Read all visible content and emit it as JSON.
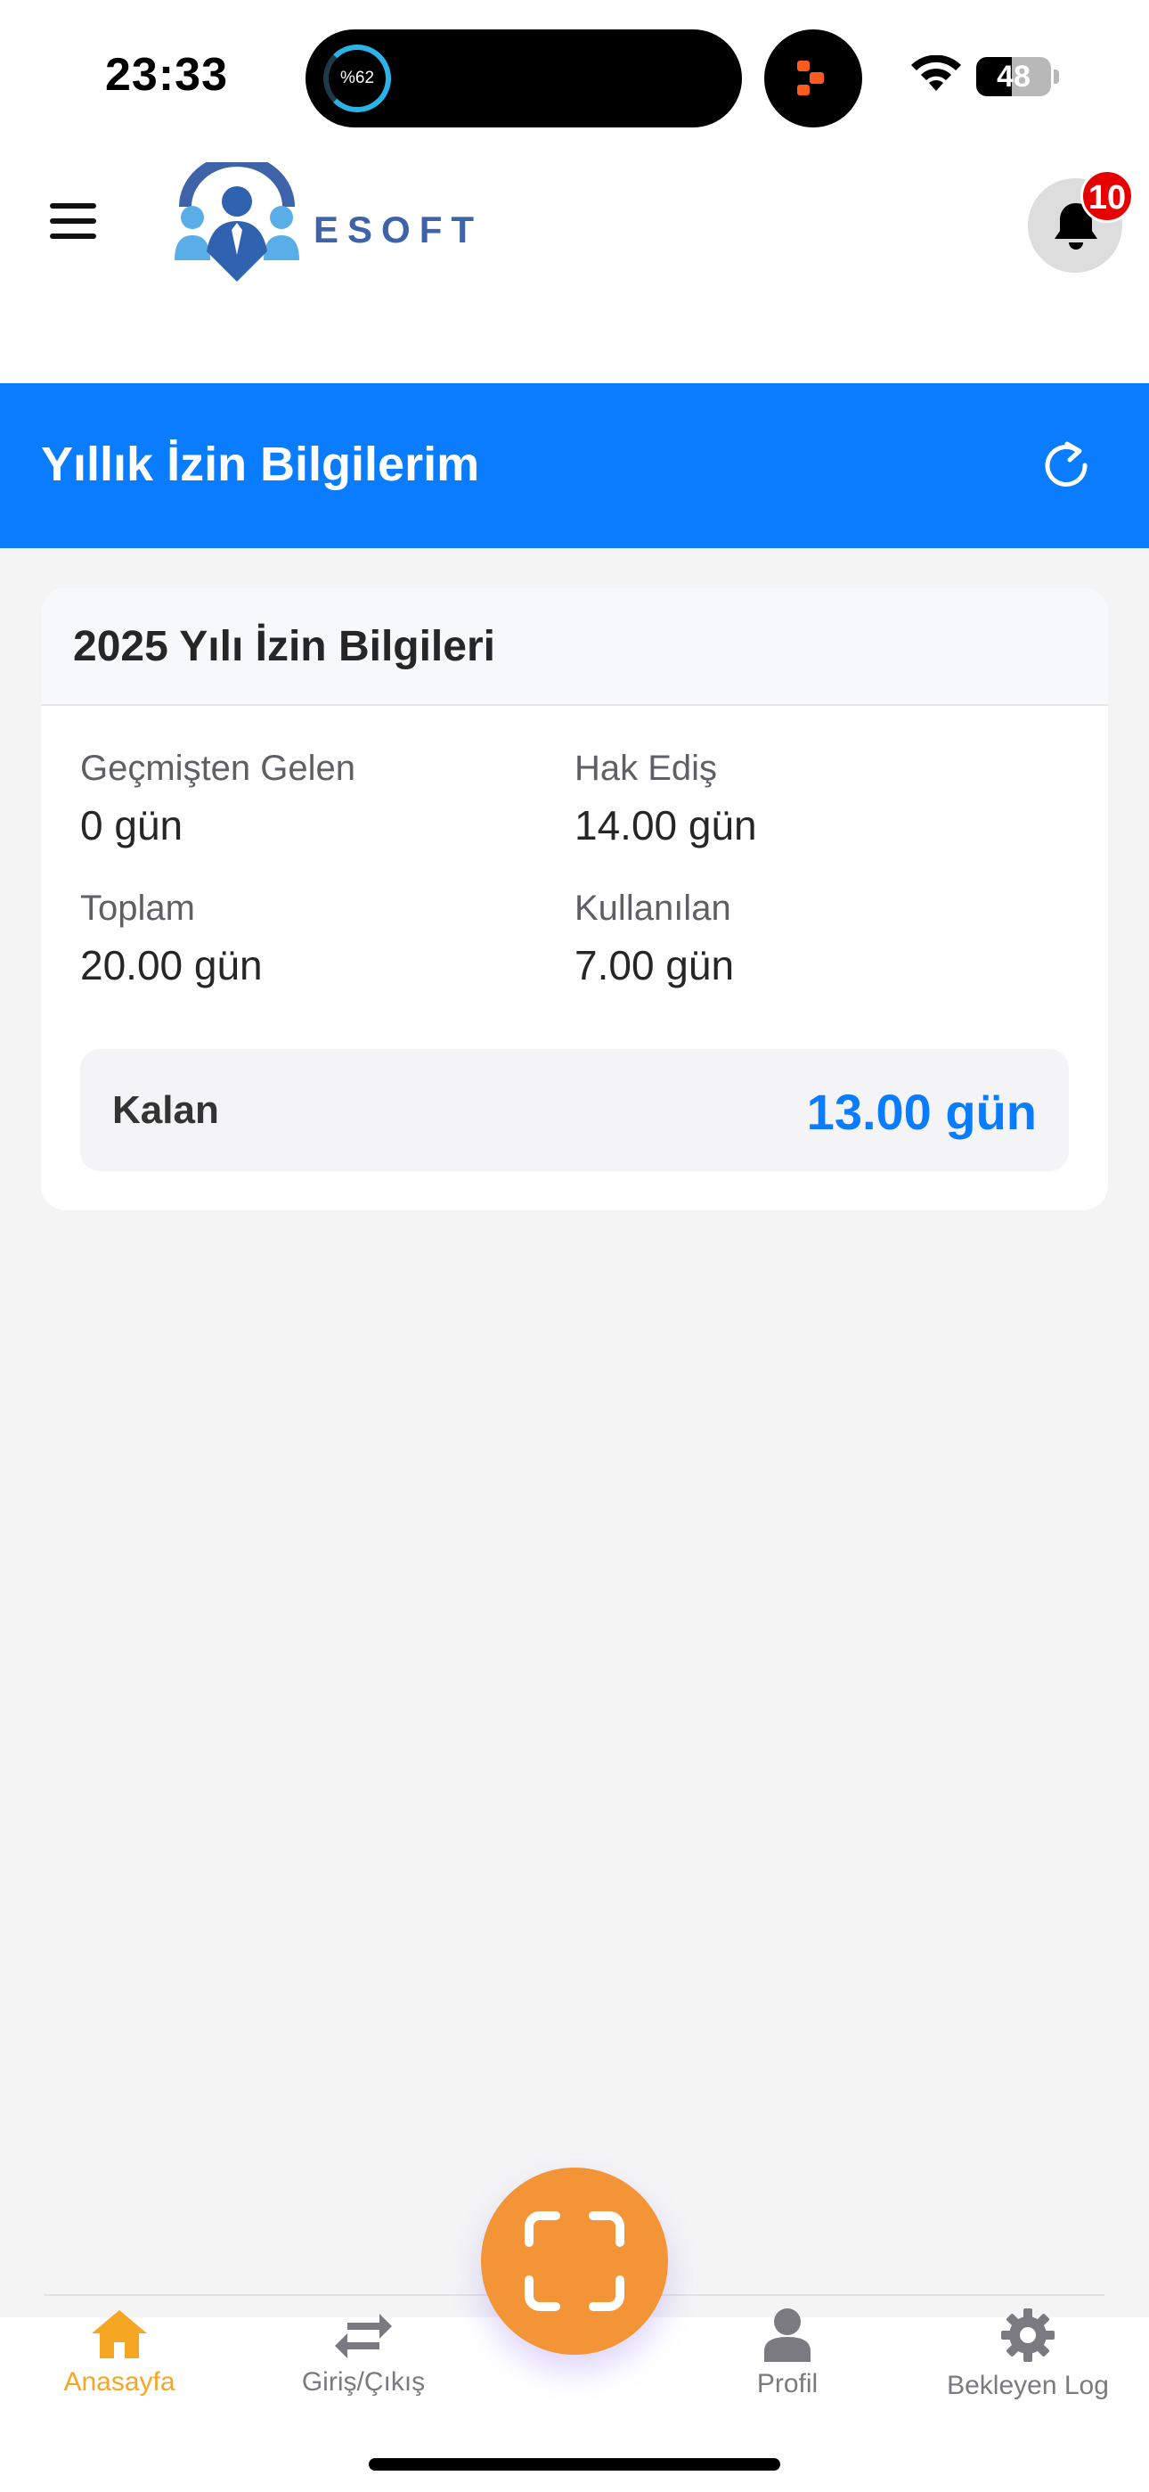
{
  "status_bar": {
    "time": "23:33",
    "activity_progress": "%62",
    "activity_progress_value": 0.62,
    "battery_level": "48",
    "battery_fraction": 0.48,
    "icons": [
      "wifi-icon",
      "battery-icon"
    ]
  },
  "header": {
    "brand": "ESOFT",
    "notification_count": "10",
    "icons": [
      "menu-icon",
      "bell-icon"
    ]
  },
  "title_bar": {
    "title": "Yıllık İzin Bilgilerim",
    "refresh_icon": "refresh-icon"
  },
  "leave_card": {
    "title": "2025 Yılı İzin Bilgileri",
    "stats": [
      {
        "label": "Geçmişten Gelen",
        "value": "0 gün"
      },
      {
        "label": "Hak Ediş",
        "value": "14.00 gün"
      },
      {
        "label": "Toplam",
        "value": "20.00 gün"
      },
      {
        "label": "Kullanılan",
        "value": "7.00 gün"
      }
    ],
    "remaining": {
      "label": "Kalan",
      "value": "13.00 gün"
    }
  },
  "bottom_nav": {
    "items": [
      {
        "label": "Anasayfa",
        "icon": "home-icon",
        "active": true
      },
      {
        "label": "Giriş/Çıkış",
        "icon": "swap-icon",
        "active": false
      },
      {
        "label": "Profil",
        "icon": "user-icon",
        "active": false
      },
      {
        "label": "Bekleyen Log",
        "icon": "gear-icon",
        "active": false
      }
    ],
    "center_action_icon": "scan-icon"
  },
  "colors": {
    "primary_blue": "#0a7cff",
    "accent_orange": "#f39536",
    "active_nav": "#f5a623",
    "badge_red": "#e60000"
  }
}
